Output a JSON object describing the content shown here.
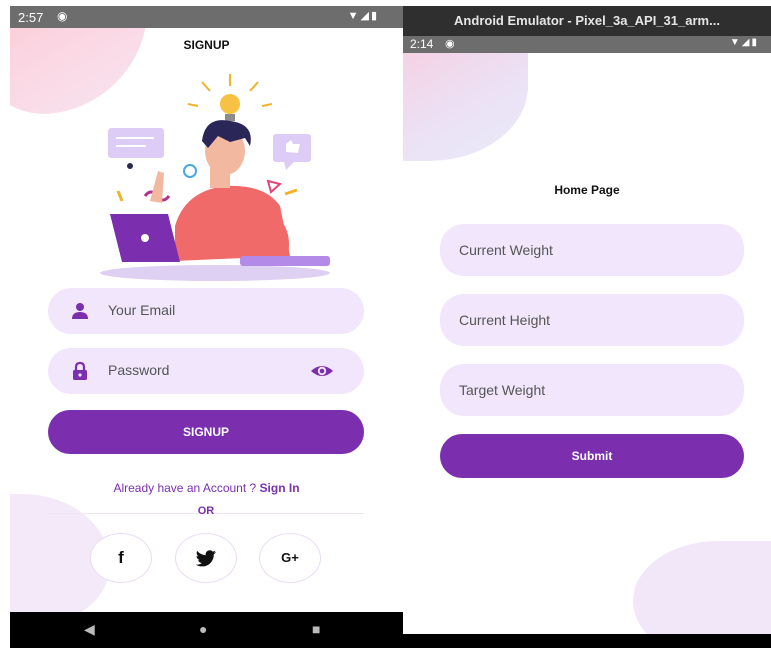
{
  "signup_screen": {
    "status_bar": {
      "time": "2:57"
    },
    "title": "SIGNUP",
    "email_placeholder": "Your Email",
    "password_placeholder": "Password",
    "signup_button": "SIGNUP",
    "account_prompt": "Already have an Account ? ",
    "sign_in_link": "Sign In",
    "or_text": "OR",
    "social": {
      "facebook": "f",
      "google": "G+"
    },
    "colors": {
      "accent": "#7b2fae",
      "field_bg": "#f1e6fb"
    },
    "icons": [
      "user-icon",
      "lock-icon",
      "eye-icon",
      "facebook-icon",
      "twitter-icon",
      "google-plus-icon",
      "back-icon",
      "home-icon",
      "recents-icon"
    ]
  },
  "home_screen": {
    "window_title": "Android Emulator - Pixel_3a_API_31_arm...",
    "status_bar": {
      "time": "2:14"
    },
    "title": "Home Page",
    "fields": [
      "Current Weight",
      "Current Height",
      "Target Weight"
    ],
    "submit_button": "Submit"
  }
}
